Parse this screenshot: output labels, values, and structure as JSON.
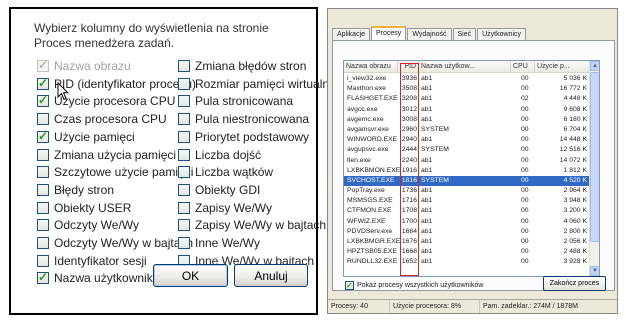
{
  "left_dialog": {
    "intro": "Wybierz kolumny do wyświetlenia na stronie Proces menedżera zadań.",
    "columns_left": [
      {
        "label": "Nazwa obrazu",
        "checked": true,
        "disabled": true
      },
      {
        "label": "PID (identyfikator procesu)",
        "checked": true,
        "disabled": false
      },
      {
        "label": "Użycie procesora CPU",
        "checked": true,
        "disabled": false
      },
      {
        "label": "Czas procesora CPU",
        "checked": false,
        "disabled": false
      },
      {
        "label": "Użycie pamięci",
        "checked": true,
        "disabled": false
      },
      {
        "label": "Zmiana użycia pamięci",
        "checked": false,
        "disabled": false
      },
      {
        "label": "Szczytowe użycie pamięci",
        "checked": false,
        "disabled": false
      },
      {
        "label": "Błędy stron",
        "checked": false,
        "disabled": false
      },
      {
        "label": "Obiekty USER",
        "checked": false,
        "disabled": false
      },
      {
        "label": "Odczyty We/Wy",
        "checked": false,
        "disabled": false
      },
      {
        "label": "Odczyty We/Wy w bajtach",
        "checked": false,
        "disabled": false
      },
      {
        "label": "Identyfikator sesji",
        "checked": false,
        "disabled": false
      },
      {
        "label": "Nazwa użytkownika",
        "checked": true,
        "disabled": false
      }
    ],
    "columns_right": [
      {
        "label": "Zmiana błędów stron",
        "checked": false,
        "disabled": false
      },
      {
        "label": "Rozmiar pamięci wirtualnej",
        "checked": false,
        "disabled": false
      },
      {
        "label": "Pula stronicowana",
        "checked": false,
        "disabled": false
      },
      {
        "label": "Pula niestronicowana",
        "checked": false,
        "disabled": false
      },
      {
        "label": "Priorytet podstawowy",
        "checked": false,
        "disabled": false
      },
      {
        "label": "Liczba dojść",
        "checked": false,
        "disabled": false
      },
      {
        "label": "Liczba wątków",
        "checked": false,
        "disabled": false
      },
      {
        "label": "Obiekty GDI",
        "checked": false,
        "disabled": false
      },
      {
        "label": "Zapisy We/Wy",
        "checked": false,
        "disabled": false
      },
      {
        "label": "Zapisy We/Wy w bajtach",
        "checked": false,
        "disabled": false
      },
      {
        "label": "Inne We/Wy",
        "checked": false,
        "disabled": false
      },
      {
        "label": "Inne We/Wy w bajtach",
        "checked": false,
        "disabled": false
      }
    ],
    "ok_label": "OK",
    "cancel_label": "Anuluj"
  },
  "task_manager": {
    "tabs": [
      {
        "label": "Aplikacje",
        "active": false
      },
      {
        "label": "Procesy",
        "active": true
      },
      {
        "label": "Wydajność",
        "active": false
      },
      {
        "label": "Sieć",
        "active": false
      },
      {
        "label": "Użytkownicy",
        "active": false
      }
    ],
    "columns": [
      "Nazwa obrazu",
      "PID",
      "Nazwa użytkow...",
      "CPU",
      "Użycie p..."
    ],
    "processes": [
      {
        "name": "i_view32.exe",
        "pid": "3936",
        "user": "ab1",
        "cpu": "00",
        "mem": "5 036 K"
      },
      {
        "name": "Maxthon.exe",
        "pid": "3508",
        "user": "ab1",
        "cpu": "00",
        "mem": "16 772 K"
      },
      {
        "name": "FLASHGET.EXE",
        "pid": "3208",
        "user": "ab1",
        "cpu": "02",
        "mem": "4 448 K"
      },
      {
        "name": "avgcc.exe",
        "pid": "3012",
        "user": "ab1",
        "cpu": "00",
        "mem": "9 608 K"
      },
      {
        "name": "avgemc.exe",
        "pid": "3008",
        "user": "ab1",
        "cpu": "00",
        "mem": "6 180 K"
      },
      {
        "name": "avgamsvr.exe",
        "pid": "2960",
        "user": "SYSTEM",
        "cpu": "00",
        "mem": "6 704 K"
      },
      {
        "name": "WINWORD.EXE",
        "pid": "2940",
        "user": "ab1",
        "cpu": "00",
        "mem": "14 448 K"
      },
      {
        "name": "avgupsvc.exe",
        "pid": "2444",
        "user": "SYSTEM",
        "cpu": "00",
        "mem": "12 516 K"
      },
      {
        "name": "tlen.exe",
        "pid": "2240",
        "user": "ab1",
        "cpu": "00",
        "mem": "14 072 K"
      },
      {
        "name": "LXBKBMON.EXE",
        "pid": "1916",
        "user": "ab1",
        "cpu": "00",
        "mem": "1 812 K"
      },
      {
        "name": "SVCHOST.EXE",
        "pid": "1816",
        "user": "SYSTEM",
        "cpu": "00",
        "mem": "4 520 K",
        "selected": true
      },
      {
        "name": "PopTray.exe",
        "pid": "1736",
        "user": "ab1",
        "cpu": "00",
        "mem": "2 964 K"
      },
      {
        "name": "MSMSGS.EXE",
        "pid": "1716",
        "user": "ab1",
        "cpu": "00",
        "mem": "3 948 K"
      },
      {
        "name": "CTFMON.EXE",
        "pid": "1708",
        "user": "ab1",
        "cpu": "00",
        "mem": "3 200 K"
      },
      {
        "name": "WFWIZ.EXE",
        "pid": "1700",
        "user": "ab1",
        "cpu": "00",
        "mem": "4 060 K"
      },
      {
        "name": "PDVDServ.exe",
        "pid": "1684",
        "user": "ab1",
        "cpu": "00",
        "mem": "2 800 K"
      },
      {
        "name": "LXBKBMGR.EXE",
        "pid": "1676",
        "user": "ab1",
        "cpu": "00",
        "mem": "2 056 K"
      },
      {
        "name": "HPZTSB05.EXE",
        "pid": "1668",
        "user": "ab1",
        "cpu": "00",
        "mem": "2 488 K"
      },
      {
        "name": "RUNDLL32.EXE",
        "pid": "1652",
        "user": "ab1",
        "cpu": "00",
        "mem": "3 928 K"
      }
    ],
    "show_all_label": "Pokaż procesy wszystkich użytkowników",
    "show_all_checked": true,
    "end_process_label": "Zakończ proces",
    "status": {
      "processes": "Procesy: 40",
      "cpu": "Użycie procesora: 8%",
      "commit": "Pam. zadeklar.: 274M / 1878M"
    }
  }
}
